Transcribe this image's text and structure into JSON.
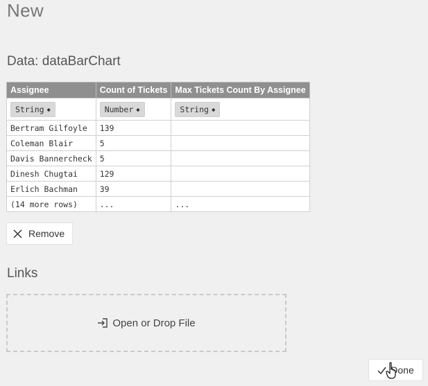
{
  "page": {
    "title": "New"
  },
  "data_section": {
    "title": "Data: dataBarChart",
    "columns": [
      {
        "header": "Assignee",
        "type": "String"
      },
      {
        "header": "Count of Tickets",
        "type": "Number"
      },
      {
        "header": "Max Tickets Count By Assignee",
        "type": "String"
      }
    ],
    "rows": [
      [
        "Bertram Gilfoyle",
        "139",
        ""
      ],
      [
        "Coleman Blair",
        "5",
        ""
      ],
      [
        "Davis Bannercheck",
        "5",
        ""
      ],
      [
        "Dinesh Chugtai",
        "129",
        ""
      ],
      [
        "Erlich Bachman",
        "39",
        ""
      ],
      [
        "(14 more rows)",
        "...",
        "..."
      ]
    ],
    "remove_label": "Remove"
  },
  "links_section": {
    "title": "Links",
    "drop_label": "Open or Drop File"
  },
  "footer": {
    "done_label": "Done"
  },
  "icons": {
    "remove": "close-icon",
    "open": "open-file-icon",
    "done": "check-icon",
    "cursor": "hand-cursor-icon"
  }
}
